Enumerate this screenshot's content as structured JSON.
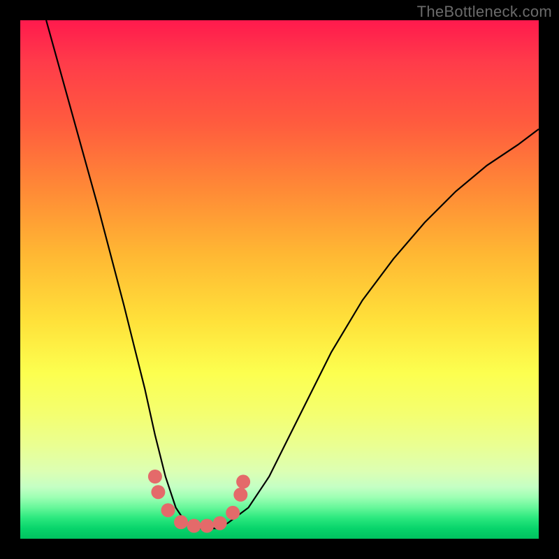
{
  "watermark": "TheBottleneck.com",
  "chart_data": {
    "type": "line",
    "title": "",
    "xlabel": "",
    "ylabel": "",
    "xlim": [
      0,
      100
    ],
    "ylim": [
      0,
      100
    ],
    "series": [
      {
        "name": "curve",
        "x": [
          5,
          10,
          15,
          20,
          22,
          24,
          26,
          28,
          30,
          32,
          34,
          36,
          38,
          40,
          44,
          48,
          52,
          56,
          60,
          66,
          72,
          78,
          84,
          90,
          96,
          100
        ],
        "y": [
          100,
          82,
          64,
          45,
          37,
          29,
          20,
          12,
          6,
          3,
          2,
          2,
          2,
          3,
          6,
          12,
          20,
          28,
          36,
          46,
          54,
          61,
          67,
          72,
          76,
          79
        ]
      }
    ],
    "markers": {
      "color": "#e46a6a",
      "points": [
        {
          "x": 26.0,
          "y": 12.0
        },
        {
          "x": 26.6,
          "y": 9.0
        },
        {
          "x": 28.5,
          "y": 5.5
        },
        {
          "x": 31.0,
          "y": 3.2
        },
        {
          "x": 33.5,
          "y": 2.5
        },
        {
          "x": 36.0,
          "y": 2.5
        },
        {
          "x": 38.5,
          "y": 3.0
        },
        {
          "x": 41.0,
          "y": 5.0
        },
        {
          "x": 42.5,
          "y": 8.5
        },
        {
          "x": 43.0,
          "y": 11.0
        }
      ]
    }
  }
}
